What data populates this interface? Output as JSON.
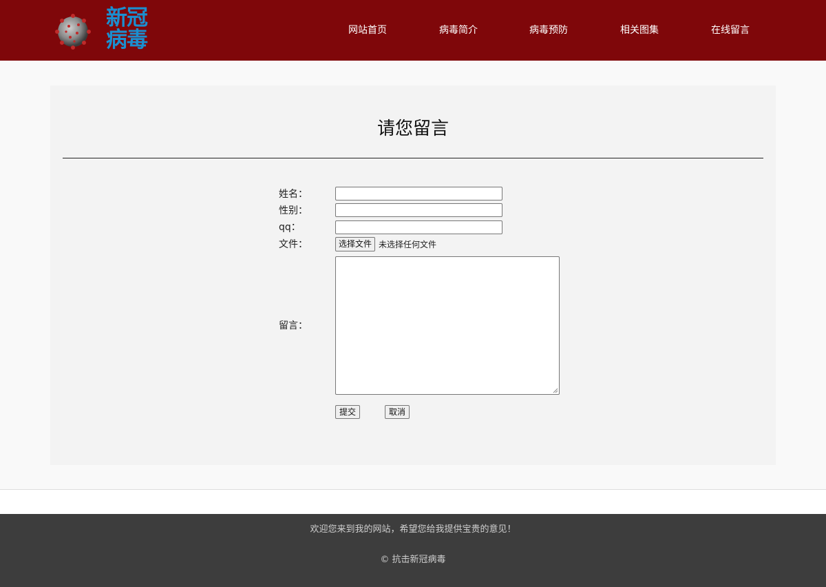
{
  "header": {
    "logo_text": "新冠病毒",
    "nav": [
      "网站首页",
      "病毒简介",
      "病毒预防",
      "相关图集",
      "在线留言"
    ]
  },
  "form": {
    "title": "请您留言",
    "name_label": "姓名：",
    "gender_label": "性别：",
    "qq_label": "qq：",
    "file_label": "文件：",
    "file_button": "选择文件",
    "file_status": "未选择任何文件",
    "message_label": "留言：",
    "submit_label": "提交",
    "cancel_label": "取消",
    "name_value": "",
    "gender_value": "",
    "qq_value": "",
    "message_value": ""
  },
  "footer": {
    "message": "欢迎您来到我的网站，希望您给我提供宝贵的意见！",
    "copyright": "© 抗击新冠病毒"
  },
  "colors": {
    "header_bg": "#7f070a",
    "logo_blue": "#1b8fd0",
    "footer_bg": "#3d3d3d"
  }
}
